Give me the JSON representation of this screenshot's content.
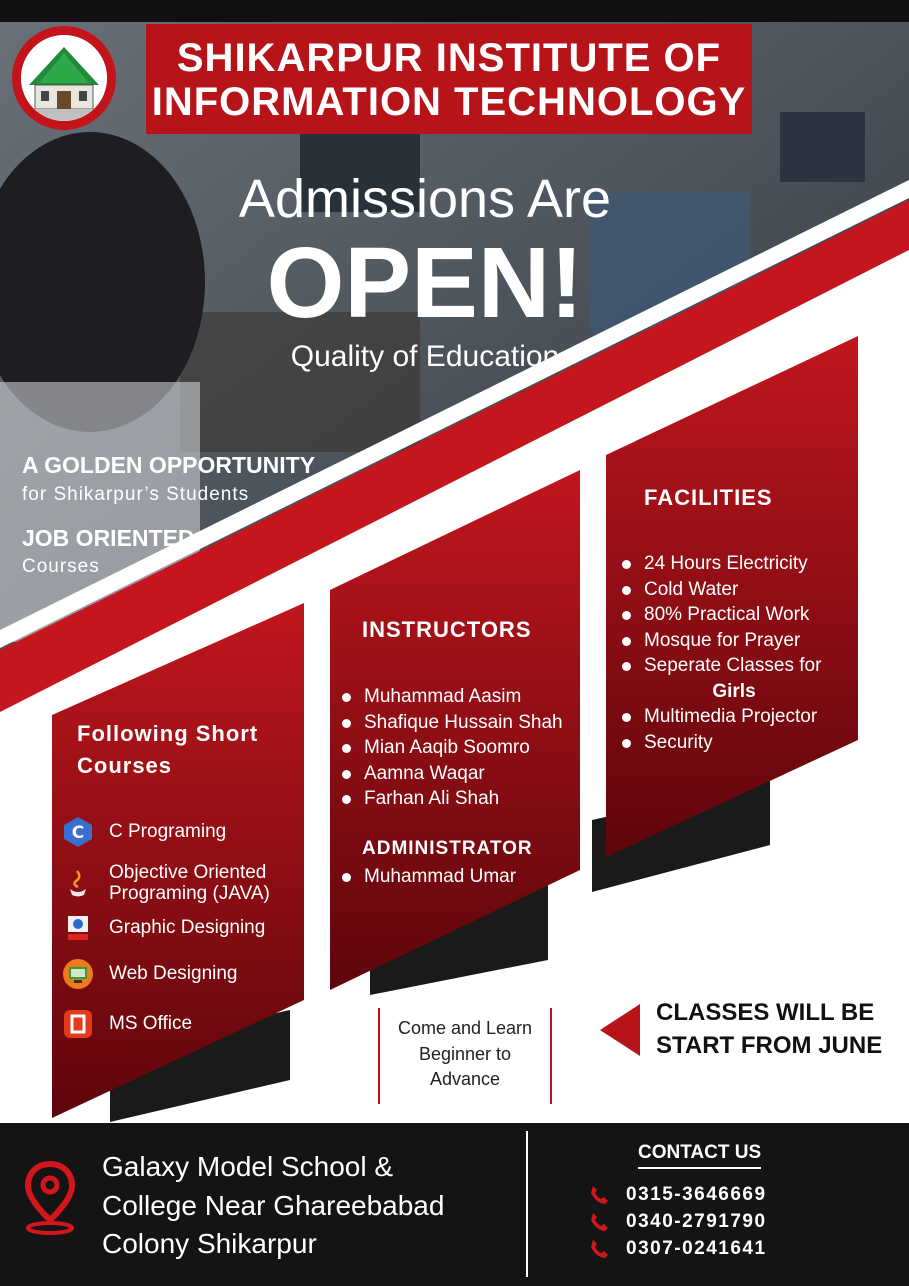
{
  "header": {
    "title_line1": "SHIKARPUR INSTITUTE OF",
    "title_line2": "INFORMATION TECHNOLOGY",
    "logo_icon": "institute-building-logo"
  },
  "hero": {
    "title": "Admissions Are",
    "highlight": "OPEN!",
    "tagline": "Quality of Education"
  },
  "promo": {
    "golden": "A GOLDEN OPPORTUNITY",
    "golden_sub": "for Shikarpur’s Students",
    "job": "JOB ORIENTED",
    "job_sub": "Courses"
  },
  "courses": {
    "title_line1": "Following Short",
    "title_line2": "Courses",
    "items": [
      {
        "line1": "C Programing",
        "line2": "",
        "icon": "c-language-icon"
      },
      {
        "line1": "Objective Oriented",
        "line2": "Programing (JAVA)",
        "icon": "java-icon"
      },
      {
        "line1": "Graphic Designing",
        "line2": "",
        "icon": "graphic-design-icon"
      },
      {
        "line1": "Web Designing",
        "line2": "",
        "icon": "web-design-icon"
      },
      {
        "line1": "MS Office",
        "line2": "",
        "icon": "ms-office-icon"
      }
    ]
  },
  "instructors": {
    "title": "INSTRUCTORS",
    "names": [
      "Muhammad Aasim",
      "Shafique Hussain Shah",
      "Mian Aaqib Soomro",
      "Aamna Waqar",
      "Farhan Ali Shah"
    ],
    "admin_title": "ADMINISTRATOR",
    "admin_names": [
      "Muhammad Umar"
    ]
  },
  "facilities": {
    "title": "FACILITIES",
    "items": [
      "24 Hours Electricity",
      "Cold Water",
      "80% Practical Work",
      "Mosque for Prayer",
      "Seperate Classes for"
    ],
    "girls": "Girls",
    "items_after": [
      "Multimedia Projector",
      "Security"
    ]
  },
  "come": {
    "line1": "Come and Learn",
    "line2": "Beginner to",
    "line3": "Advance"
  },
  "classes": {
    "line1": "CLASSES WILL BE",
    "line2": "START FROM JUNE"
  },
  "footer": {
    "address_line1": "Galaxy Model School &",
    "address_line2": "College Near Ghareebabad",
    "address_line3": "Colony Shikarpur",
    "location_icon": "map-pin-icon",
    "contact_title": "CONTACT US",
    "phones": [
      "0315-3646669",
      "0340-2791790",
      "0307-0241641"
    ],
    "phone_icon": "phone-icon"
  },
  "colors": {
    "brand_red": "#b7141a",
    "dark_red": "#6e0810",
    "footer_bg": "#141414"
  }
}
